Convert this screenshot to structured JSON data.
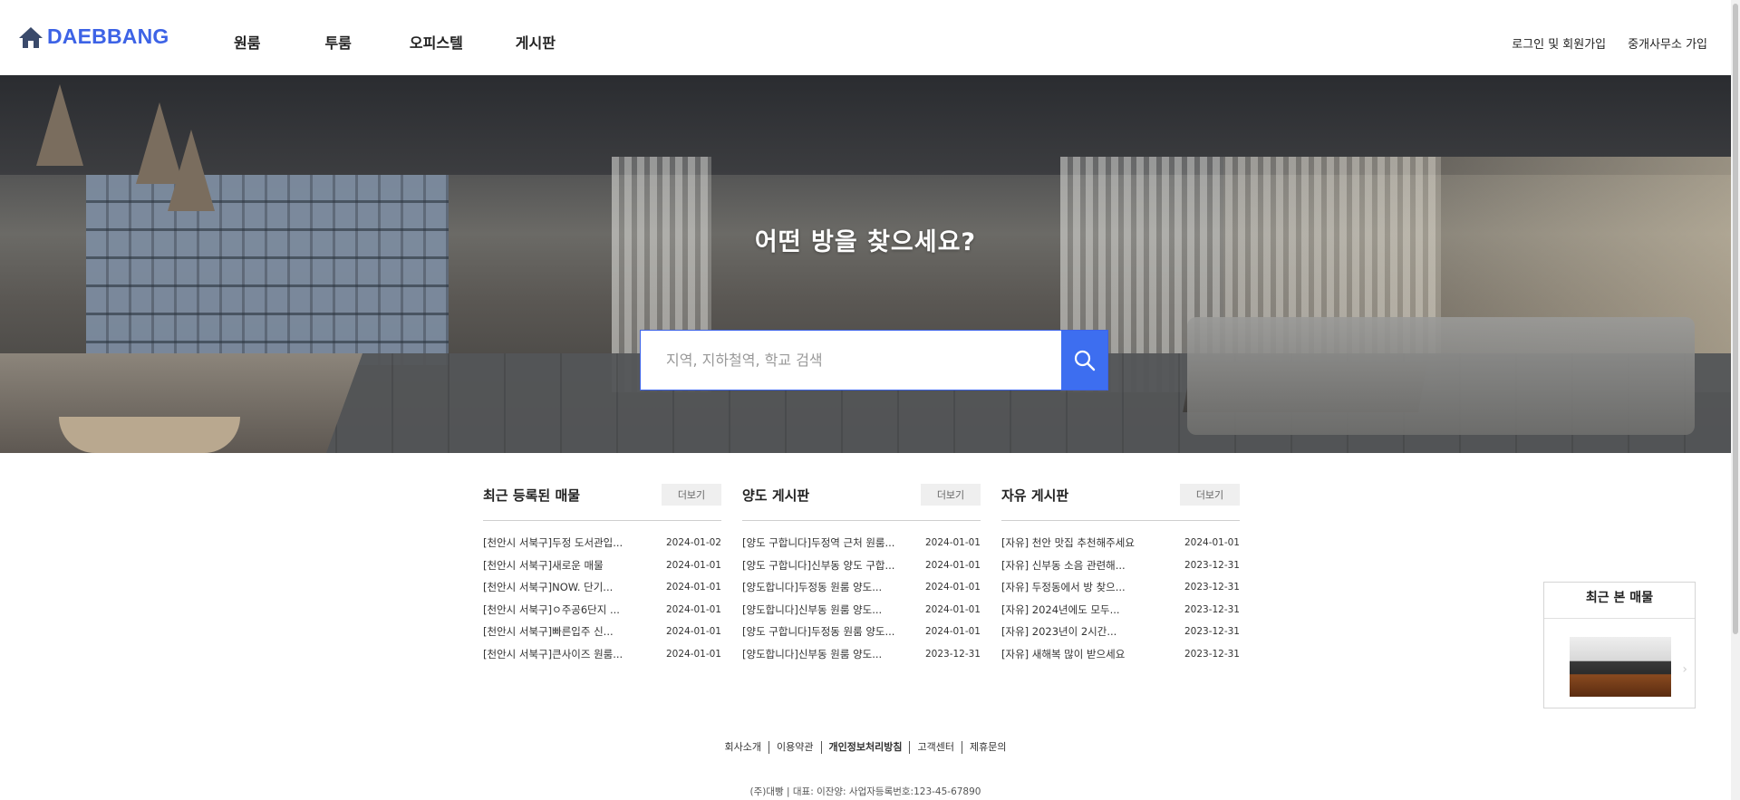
{
  "header": {
    "logo_text": "DAEBBANG",
    "logo_icon": "home-icon",
    "nav": [
      "원룸",
      "투룸",
      "오피스텔",
      "게시판"
    ],
    "login_label": "로그인 및 회원가입",
    "agency_signup_label": "중개사무소 가입"
  },
  "hero": {
    "title": "어떤 방을 찾으세요?",
    "search_placeholder": "지역, 지하철역, 학교 검색",
    "search_icon": "search-icon",
    "button_color": "#3d6ef0"
  },
  "boards": [
    {
      "title": "최근 등록된 매물",
      "more_label": "더보기",
      "rows": [
        {
          "title": "[천안시 서북구]두정 도서관입...",
          "date": "2024-01-02"
        },
        {
          "title": "[천안시 서북구]새로운 매물",
          "date": "2024-01-01"
        },
        {
          "title": "[천안시 서북구]NOW. 단기...",
          "date": "2024-01-01"
        },
        {
          "title": "[천안시 서북구]ㅇ주공6단지 ...",
          "date": "2024-01-01"
        },
        {
          "title": "[천안시 서북구]빠른입주 신...",
          "date": "2024-01-01"
        },
        {
          "title": "[천안시 서북구]큰사이즈 원룸...",
          "date": "2024-01-01"
        }
      ]
    },
    {
      "title": "양도 게시판",
      "more_label": "더보기",
      "rows": [
        {
          "title": "[양도 구합니다]두정역 근처 원룸...",
          "date": "2024-01-01"
        },
        {
          "title": "[양도 구합니다]신부동 양도 구합...",
          "date": "2024-01-01"
        },
        {
          "title": "[양도합니다]두정동 원룸 양도...",
          "date": "2024-01-01"
        },
        {
          "title": "[양도합니다]신부동 원룸 양도...",
          "date": "2024-01-01"
        },
        {
          "title": "[양도 구합니다]두정동 원룸 양도...",
          "date": "2024-01-01"
        },
        {
          "title": "[양도합니다]신부동 원룸 양도...",
          "date": "2023-12-31"
        }
      ]
    },
    {
      "title": "자유 게시판",
      "more_label": "더보기",
      "rows": [
        {
          "title": "[자유] 천안 맛집 추천해주세요",
          "date": "2024-01-01"
        },
        {
          "title": "[자유] 신부동 소음 관련해...",
          "date": "2023-12-31"
        },
        {
          "title": "[자유] 두정동에서 방 찾으...",
          "date": "2023-12-31"
        },
        {
          "title": "[자유] 2024년에도 모두...",
          "date": "2023-12-31"
        },
        {
          "title": "[자유] 2023년이 2시간...",
          "date": "2023-12-31"
        },
        {
          "title": "[자유] 새해복 많이 받으세요",
          "date": "2023-12-31"
        }
      ]
    }
  ],
  "recent_viewed": {
    "title": "최근 본 매물",
    "arrow_icon": "chevron-right-icon"
  },
  "footer": {
    "links": [
      "회사소개",
      "이용약관",
      "개인정보처리방침",
      "고객센터",
      "제휴문의"
    ],
    "info": "(주)대빵 | 대표: 이잔양: 사업자등록번호:123-45-67890"
  }
}
